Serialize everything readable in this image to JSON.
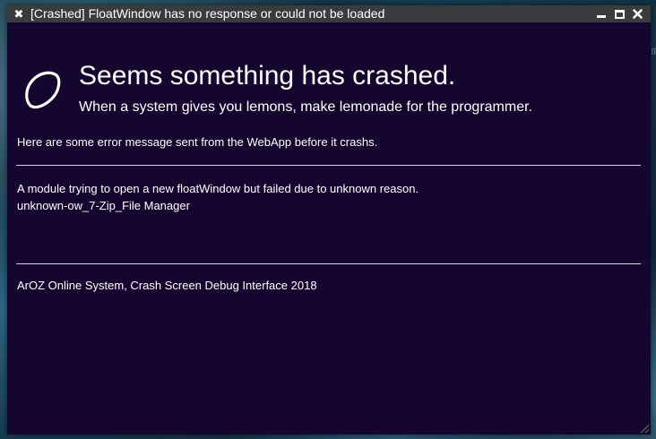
{
  "window": {
    "title": "[Crashed] FloatWindow has no response or could not be loaded",
    "close_glyph": "✖",
    "controls": {
      "minimize_icon": "minimize-icon",
      "maximize_icon": "maximize-icon",
      "close_icon": "close-icon"
    },
    "colors": {
      "titlebar": "#3a3b3d",
      "body": "#14062f",
      "text": "#ffffff"
    }
  },
  "crash": {
    "icon": "lemon-icon",
    "headline": "Seems something has crashed.",
    "subline": "When a system gives you lemons, make lemonade for the programmer.",
    "intro": "Here are some error message sent from the WebApp before it crashs.",
    "message_lines": [
      "A module trying to open a new floatWindow but failed due to unknown reason.",
      "unknown-ow_7-Zip_File Manager"
    ],
    "footer": "ArOZ Online System, Crash Screen Debug Interface 2018"
  },
  "desktop": {
    "side_mark": "⠿"
  }
}
